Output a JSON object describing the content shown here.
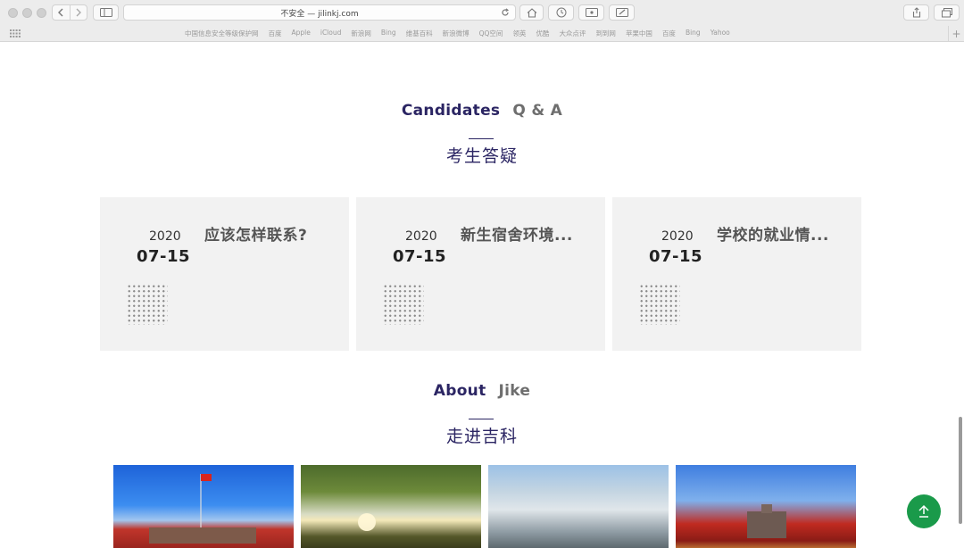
{
  "browser": {
    "address_text": "不安全 — jilinkj.com",
    "favorites": [
      "中国信息安全等级保护网",
      "百度",
      "Apple",
      "iCloud",
      "新浪网",
      "Bing",
      "维基百科",
      "新浪微博",
      "QQ空间",
      "领英",
      "优酷",
      "大众点评",
      "到到网",
      "苹果中国",
      "百度",
      "Bing",
      "Yahoo"
    ]
  },
  "qa_section": {
    "title_strong": "Candidates",
    "title_light": "Q & A",
    "subtitle": "考生答疑",
    "cards": [
      {
        "year": "2020",
        "date": "07-15",
        "question": "应该怎样联系?"
      },
      {
        "year": "2020",
        "date": "07-15",
        "question": "新生宿舍环境..."
      },
      {
        "year": "2020",
        "date": "07-15",
        "question": "学校的就业情..."
      }
    ]
  },
  "about_section": {
    "title_strong": "About",
    "title_light": "Jike",
    "subtitle": "走进吉科"
  },
  "colors": {
    "brand": "#2b2563",
    "card_bg": "#f2f2f2",
    "back_to_top": "#1a9a4a"
  }
}
